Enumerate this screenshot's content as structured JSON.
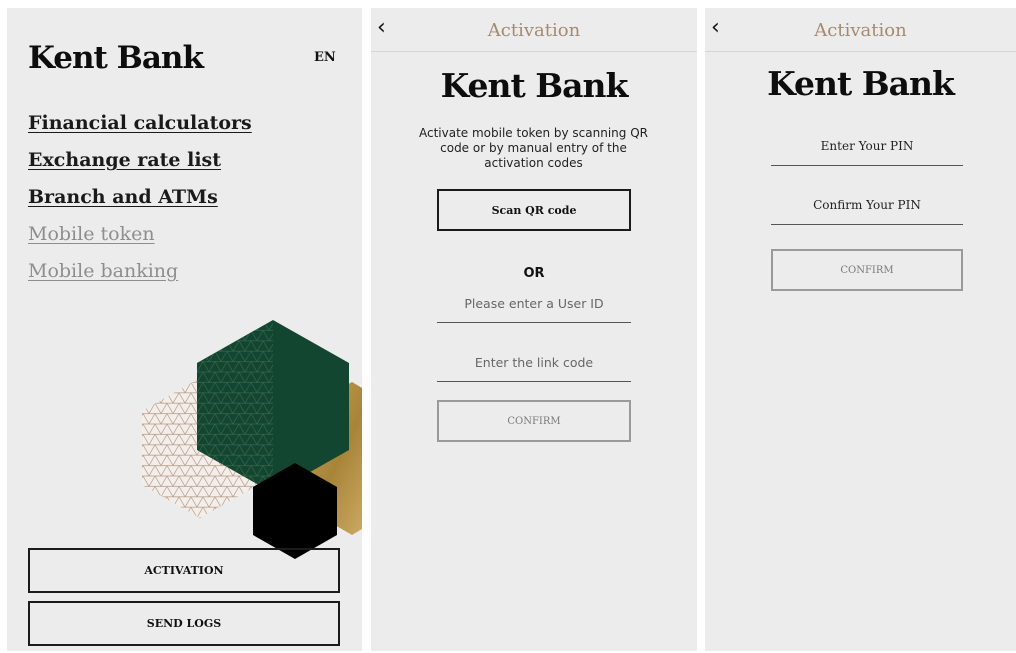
{
  "screen1": {
    "logo": "Kent Bank",
    "language": "EN",
    "menu": [
      {
        "label": "Financial calculators"
      },
      {
        "label": "Exchange rate list"
      },
      {
        "label": "Branch and ATMs"
      },
      {
        "label": "Mobile token"
      },
      {
        "label": "Mobile banking"
      }
    ],
    "buttons": {
      "activation": "ACTIVATION",
      "send_logs": "SEND LOGS"
    },
    "colors": {
      "green": "#134630",
      "gold": "#b8944a",
      "black": "#000000",
      "pattern": "#b59a87"
    }
  },
  "screen2": {
    "header_title": "Activation",
    "back_icon": "chevron-left-icon",
    "logo": "Kent Bank",
    "description": "Activate mobile token by scanning QR code or by manual entry of the activation codes",
    "scan_button": "Scan QR code",
    "or_label": "OR",
    "user_id_placeholder": "Please enter a User ID",
    "link_code_placeholder": "Enter the link code",
    "confirm_button": "CONFIRM"
  },
  "screen3": {
    "header_title": "Activation",
    "back_icon": "chevron-left-icon",
    "logo": "Kent Bank",
    "pin_placeholder": "Enter Your PIN",
    "confirm_pin_placeholder": "Confirm Your PIN",
    "confirm_button": "CONFIRM"
  },
  "accent_color": "#a48b6f"
}
